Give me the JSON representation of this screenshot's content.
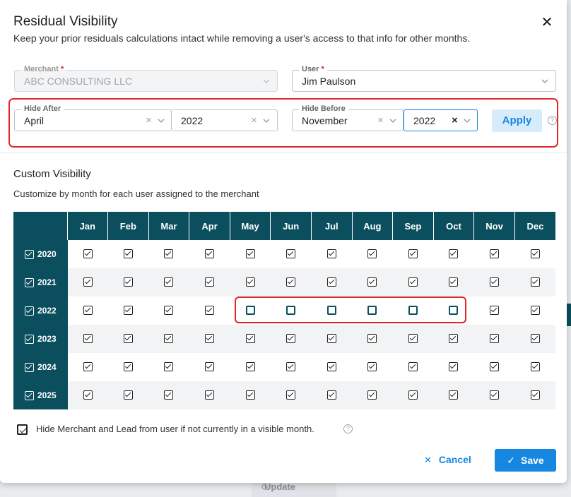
{
  "dialog": {
    "title": "Residual Visibility",
    "close_icon": "close-icon",
    "subtitle": "Keep your prior residuals calculations intact while removing a user's access to that info for other months."
  },
  "fields": {
    "merchant": {
      "label": "Merchant",
      "required": "*",
      "value": "ABC CONSULTING LLC",
      "disabled": true
    },
    "user": {
      "label": "User",
      "required": "*",
      "value": "Jim Paulson"
    },
    "hide_after": {
      "label": "Hide After",
      "month": "April",
      "year": "2022"
    },
    "hide_before": {
      "label": "Hide Before",
      "month": "November",
      "year": "2022"
    }
  },
  "buttons": {
    "apply": "Apply",
    "cancel": "Cancel",
    "save": "Save",
    "clear_symbol": "×",
    "cancel_symbol": "✕",
    "save_symbol": "✓",
    "help_symbol": "?"
  },
  "custom_visibility": {
    "title": "Custom Visibility",
    "subtitle": "Customize by month for each user assigned to the merchant",
    "months": [
      "Jan",
      "Feb",
      "Mar",
      "Apr",
      "May",
      "Jun",
      "Jul",
      "Aug",
      "Sep",
      "Oct",
      "Nov",
      "Dec"
    ],
    "rows": [
      {
        "year": "2020",
        "checked": [
          true,
          true,
          true,
          true,
          true,
          true,
          true,
          true,
          true,
          true,
          true,
          true
        ]
      },
      {
        "year": "2021",
        "checked": [
          true,
          true,
          true,
          true,
          true,
          true,
          true,
          true,
          true,
          true,
          true,
          true
        ]
      },
      {
        "year": "2022",
        "checked": [
          true,
          true,
          true,
          true,
          false,
          false,
          false,
          false,
          false,
          false,
          true,
          true
        ]
      },
      {
        "year": "2023",
        "checked": [
          true,
          true,
          true,
          true,
          true,
          true,
          true,
          true,
          true,
          true,
          true,
          true
        ]
      },
      {
        "year": "2024",
        "checked": [
          true,
          true,
          true,
          true,
          true,
          true,
          true,
          true,
          true,
          true,
          true,
          true
        ]
      },
      {
        "year": "2025",
        "checked": [
          true,
          true,
          true,
          true,
          true,
          true,
          true,
          true,
          true,
          true,
          true,
          true
        ]
      }
    ]
  },
  "hide_merchant_option": {
    "label": "Hide Merchant and Lead from user if not currently in a visible month.",
    "checked": true
  },
  "background": {
    "update_label": "Update"
  },
  "colors": {
    "table_header": "#0b4f5e",
    "accent": "#1687e0",
    "highlight": "#e0262b"
  }
}
